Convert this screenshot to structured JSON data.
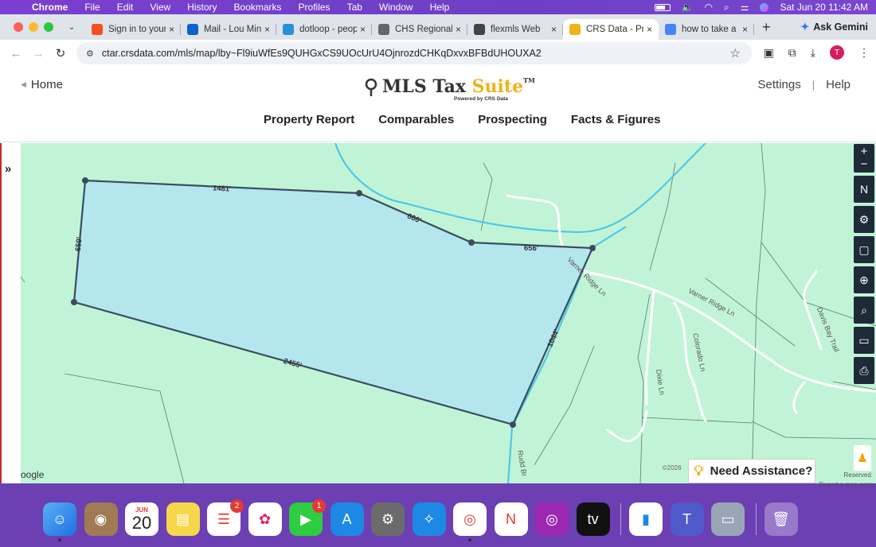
{
  "menubar": {
    "items": [
      "Chrome",
      "File",
      "Edit",
      "View",
      "History",
      "Bookmarks",
      "Profiles",
      "Tab",
      "Window",
      "Help"
    ],
    "clock": "Sat Jun 20  11:42 AM"
  },
  "tabs": [
    {
      "title": "Sign in to your",
      "icon": "microsoft-icon",
      "color": "#f25022"
    },
    {
      "title": "Mail - Lou Minu",
      "icon": "outlook-icon",
      "color": "#0a64c8"
    },
    {
      "title": "dotloop - peopl",
      "icon": "dotloop-icon",
      "color": "#2a8fd8"
    },
    {
      "title": "CHS Regional M",
      "icon": "document-icon",
      "color": "#666666"
    },
    {
      "title": "flexmls Web",
      "icon": "location-icon",
      "color": "#444444"
    },
    {
      "title": "CRS Data - Pro",
      "icon": "crs-icon",
      "color": "#f0b21b",
      "active": true
    },
    {
      "title": "how to take a s",
      "icon": "google-icon",
      "color": "#4285f4"
    }
  ],
  "ask_gemini": "Ask Gemini",
  "address_bar": {
    "url": "ctar.crsdata.com/mls/map/lby~Fl9iuWfEs9QUHGxCS9UOcUrU4OjnrozdCHKqDxvxBFBdUHOUXA2"
  },
  "profile_initial": "T",
  "site": {
    "home": "Home",
    "logo_main": "MLS Tax ",
    "logo_accent": "Suite",
    "logo_tm": "TM",
    "logo_sub": "Powered by CRS Data",
    "settings": "Settings",
    "help": "Help",
    "nav": [
      "Property Report",
      "Comparables",
      "Prospecting",
      "Facts & Figures"
    ]
  },
  "map": {
    "parcel_dimensions": [
      "1481'",
      "660'",
      "656'",
      "659'",
      "1044'",
      "2455'"
    ],
    "streets": [
      "Varner Ridge Ln",
      "Varner Ridge Ln",
      "Colorado Ln",
      "Dixie Ln",
      "Davis Bay Trail",
      "Rudd Br"
    ],
    "attribution_left": "oogle",
    "attribution_year": "©2026",
    "attribution_right": "Reserved.",
    "report_error": "Report a map error",
    "need_assistance": "Need Assistance?",
    "controls": [
      "zoom-in",
      "zoom-out",
      "compass",
      "settings",
      "select-area",
      "locate",
      "search",
      "measure",
      "print"
    ]
  },
  "dock": {
    "calendar_month": "JUN",
    "calendar_day": "20",
    "reminders_badge": "2",
    "facetime_badge": "1"
  }
}
